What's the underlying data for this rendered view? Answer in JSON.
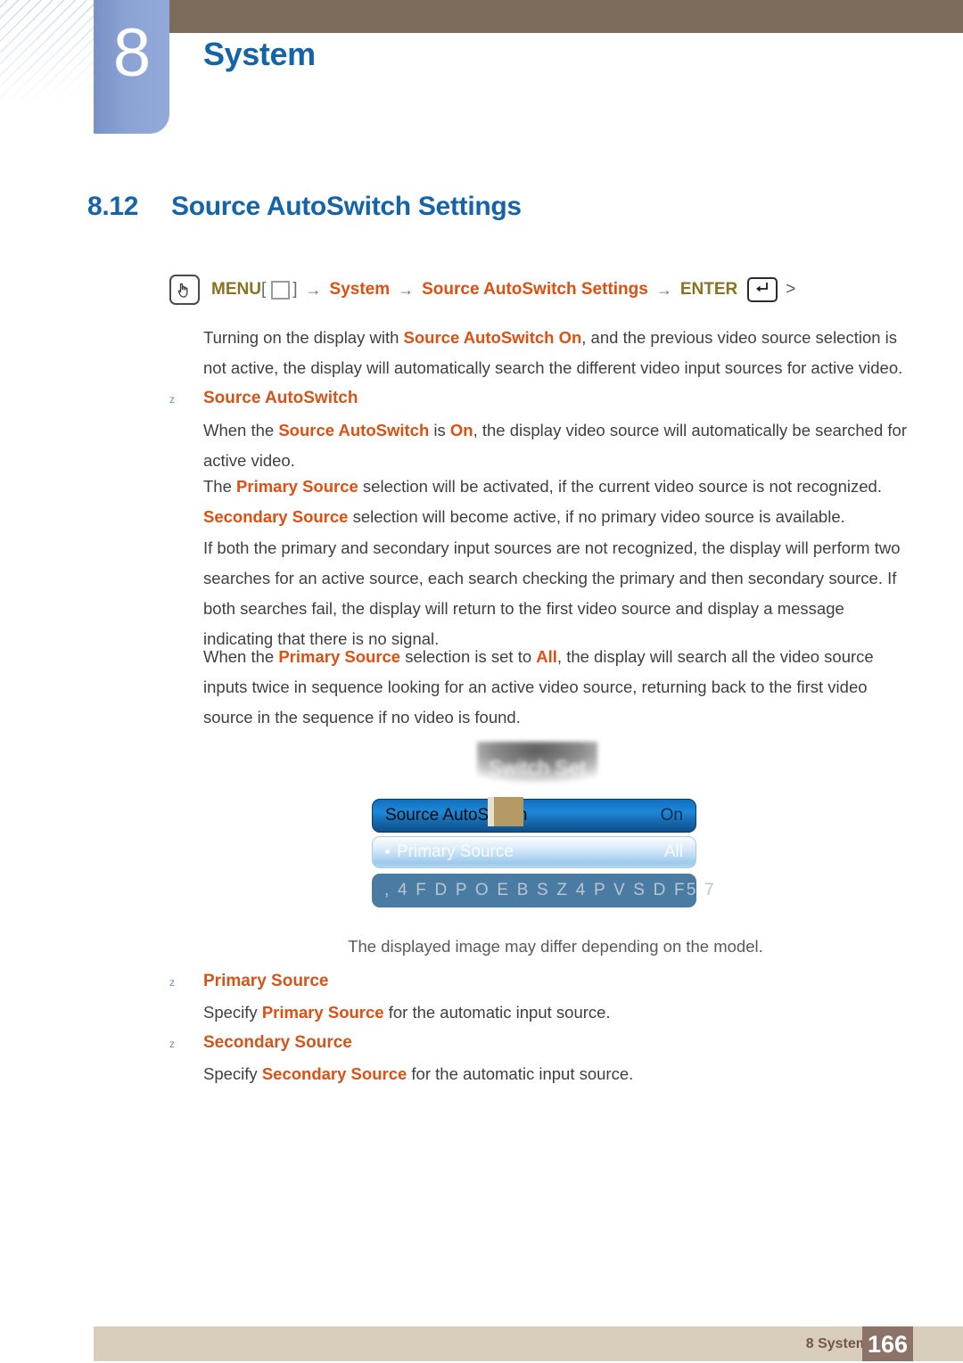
{
  "header": {
    "chapter_number": "8",
    "chapter_title": "System"
  },
  "section": {
    "number": "8.12",
    "title": "Source AutoSwitch Settings"
  },
  "menu_path": {
    "hand_icon": "hand-press-icon",
    "menu_label": "MENU",
    "square_icon": "square-button-icon",
    "bracket_open": "[",
    "bracket_close": "]",
    "arrow": "→",
    "node_system": "System",
    "node_settings": "Source AutoSwitch Settings",
    "enter_label": "ENTER",
    "enter_icon": "enter-key-icon",
    "chevron": ">"
  },
  "intro": {
    "text_1": "Turning on the display with ",
    "hl_1": "Source AutoSwitch On",
    "text_2": ", and the previous video source selection is not active, the display will automatically search the different video input sources for active video."
  },
  "bullets": [
    {
      "marker": "z",
      "heading": "Source AutoSwitch",
      "paragraphs": [
        {
          "t1": "When the ",
          "h1": "Source AutoSwitch",
          "t2": " is ",
          "h2": "On",
          "t3": ", the display video source will automatically be searched for active video."
        },
        {
          "t1": "The ",
          "h1": "Primary Source",
          "t2": " selection will be activated, if the current video source is not recognized."
        },
        {
          "h1": "Secondary Source",
          "t2": " selection will become active, if no primary video source is available."
        },
        {
          "t1": "If both the primary and secondary input sources are not recognized, the display will perform two searches for an active source, each search checking the primary and then secondary source. If both searches fail, the display will return to the first video source and display a message indicating that there is no signal."
        },
        {
          "t1": "When the ",
          "h1": "Primary Source",
          "t2": " selection is set to ",
          "h2": "All",
          "t3": ", the display will search all the video source inputs twice in sequence looking for an active video source, returning back to the first video source in the sequence if no video is found."
        }
      ]
    },
    {
      "marker": "z",
      "heading": "Primary Source",
      "body_t1": "Specify ",
      "body_h1": "Primary Source",
      "body_t2": " for the automatic input source."
    },
    {
      "marker": "z",
      "heading": "Secondary Source",
      "body_t1": "Specify ",
      "body_h1": "Secondary Source",
      "body_t2": " for the automatic input source."
    }
  ],
  "osd": {
    "blurred_title": "Switch Set",
    "rows": [
      {
        "label": "Source AutoSwitch",
        "value": "On"
      },
      {
        "label": "Primary Source",
        "value": "All"
      },
      {
        "label": ", 4 F D P O E B S Z  4 P V S D F",
        "value": "5 7"
      }
    ],
    "caption": "The displayed image may differ depending on the model."
  },
  "footer": {
    "label": "8 System",
    "page": "166"
  },
  "colors": {
    "heading_blue": "#1464aa",
    "highlight_orange": "#e04e10",
    "bullet_orange": "#d4541a",
    "menu_gold": "#8a7222",
    "chapter_tab": "#8ba3d4",
    "header_brown": "#7d6c5b",
    "footer_band": "#d9cdbc",
    "footer_pagebox": "#8d7268"
  }
}
